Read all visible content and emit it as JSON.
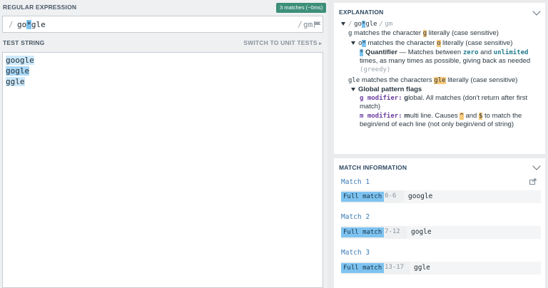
{
  "regex": {
    "header": "REGULAR EXPRESSION",
    "badge": "3 matches (~0ms)",
    "open_delim": "/",
    "pattern_pre": "go",
    "pattern_quant": "*",
    "pattern_post": "gle",
    "close_delim": "/",
    "flags": "gm"
  },
  "test": {
    "header": "TEST STRING",
    "switch_label": "SWITCH TO UNIT TESTS",
    "lines": [
      "google",
      "gogle",
      "ggle"
    ]
  },
  "explanation": {
    "header": "EXPLANATION",
    "root": {
      "d1": "/",
      "pre": "go",
      "quant": "*",
      "post": "gle",
      "d2": "/",
      "flags": "gm"
    },
    "g_line": {
      "code": "g",
      "text1": " matches the character ",
      "hl": "g",
      "text2": " literally (case sensitive)"
    },
    "o_line": {
      "code": "o",
      "quant": "*",
      "text1": " matches the character ",
      "hl": "o",
      "text2": " literally (case sensitive)"
    },
    "quant_line": {
      "sym": "*",
      "label": " Quantifier",
      "text1": " — Matches between ",
      "zero": "zero",
      "and": " and ",
      "unl": "unlimited",
      "text2": " times, as many times as possible, giving back as needed ",
      "greedy": "(greedy)"
    },
    "gle_line": {
      "code": "gle",
      "text1": " matches the characters ",
      "hl": "gle",
      "text2": " literally (case sensitive)"
    },
    "flags_title": "Global pattern flags",
    "g_mod": {
      "kw": "g modifier:",
      "bold": " g",
      "text": "lobal. All matches (don't return after first match)"
    },
    "m_mod": {
      "kw": "m modifier:",
      "bold": " m",
      "text1": "ulti line. Causes ",
      "caret": "^",
      "and": " and ",
      "dollar": "$",
      "text2": " to match the begin/end of each line (not only begin/end of string)"
    }
  },
  "match_info": {
    "header": "MATCH INFORMATION",
    "matches": [
      {
        "title": "Match 1",
        "label": "Full match",
        "range": "0-6",
        "value": "google"
      },
      {
        "title": "Match 2",
        "label": "Full match",
        "range": "7-12",
        "value": "gogle"
      },
      {
        "title": "Match 3",
        "label": "Full match",
        "range": "13-17",
        "value": "ggle"
      }
    ]
  },
  "colors": {
    "badge": "#3d8f7a",
    "match_highlight": "#7ec3f0",
    "literal_highlight": "#f7c97a",
    "header_blue": "#2e4a63"
  },
  "icons": [
    "flag-icon",
    "chevron-down-icon",
    "share-icon"
  ]
}
